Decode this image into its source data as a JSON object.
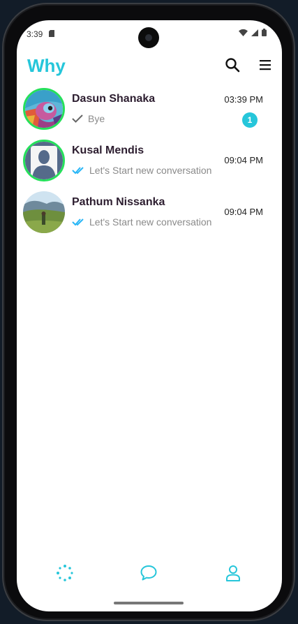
{
  "status_bar": {
    "time": "3:39"
  },
  "app_bar": {
    "title": "Why"
  },
  "chats": [
    {
      "name": "Dasun Shanaka",
      "last_message": "Bye",
      "time": "03:39 PM",
      "unread": "1",
      "status": "sent",
      "online": true
    },
    {
      "name": "Kusal Mendis",
      "last_message": "Let's Start new conversation",
      "time": "09:04 PM",
      "status": "read",
      "online": true
    },
    {
      "name": "Pathum Nissanka",
      "last_message": "Let's Start new conversation",
      "time": "09:04 PM",
      "status": "read",
      "online": false
    }
  ],
  "bottom_nav": [
    {
      "icon": "status-icon"
    },
    {
      "icon": "chat-bubble-icon"
    },
    {
      "icon": "profile-icon"
    }
  ],
  "colors": {
    "accent": "#26c6da",
    "online_ring": "#25e05a",
    "read_tick": "#29b6f6"
  }
}
